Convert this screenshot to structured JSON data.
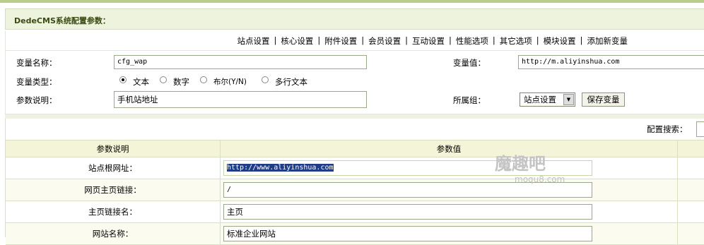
{
  "header": {
    "title": "DedeCMS系统配置参数："
  },
  "nav": {
    "items": [
      "站点设置",
      "核心设置",
      "附件设置",
      "会员设置",
      "互动设置",
      "性能选项",
      "其它选项",
      "模块设置",
      "添加新变量"
    ],
    "separator": "|"
  },
  "form": {
    "var_name_label": "变量名称：",
    "var_name_value": "cfg_wap",
    "var_value_label": "变量值：",
    "var_value_value": "http://m.aliyinshua.com",
    "var_type_label": "变量类型：",
    "var_types": [
      {
        "label": "文本",
        "checked": true
      },
      {
        "label": "数字",
        "checked": false
      },
      {
        "label": "布尔(Y/N)",
        "checked": false
      },
      {
        "label": "多行文本",
        "checked": false
      }
    ],
    "desc_label": "参数说明：",
    "desc_value": "手机站地址",
    "group_label": "所属组：",
    "group_selected": "站点设置",
    "save_button": "保存变量"
  },
  "search": {
    "label": "配置搜索："
  },
  "table": {
    "headers": [
      "参数说明",
      "参数值"
    ],
    "rows": [
      {
        "label": "站点根网址：",
        "value": "http://www.aliyinshua.com"
      },
      {
        "label": "网页主页链接：",
        "value": "/"
      },
      {
        "label": "主页链接名：",
        "value": "主页"
      },
      {
        "label": "网站名称：",
        "value": "标准企业网站"
      }
    ]
  },
  "watermark": {
    "brand": "魔趣吧",
    "site": "moqu8.com"
  },
  "colors": {
    "title_bg": "#eef3dd",
    "header_bg": "#f4f5d8",
    "selection": "#1f3c88"
  }
}
